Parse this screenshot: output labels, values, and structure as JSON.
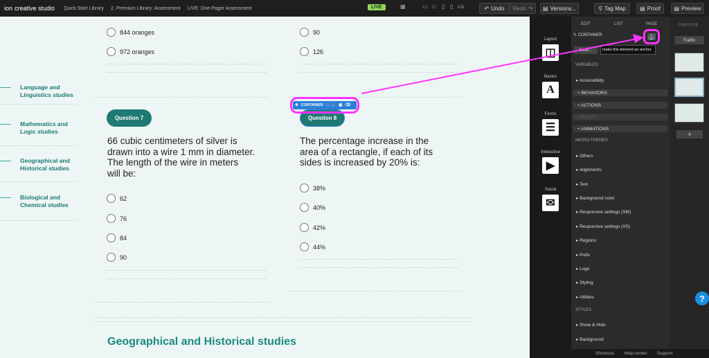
{
  "topbar": {
    "logo_ion": "ion",
    "logo_text": "creative studio",
    "breadcrumbs": [
      "Quick Start Library",
      "2. Premium Library: Assessment",
      "LIVE: One-Pager Assessment"
    ],
    "live_badge": "LIVE",
    "device_label": "LG",
    "undo": "Undo",
    "redo": "Redo",
    "versions": "Versions...",
    "tagmap": "Tag Map",
    "proof": "Proof",
    "preview": "Preview"
  },
  "sidebar_nav": [
    {
      "line1": "Language and",
      "line2": "Linguistics studies"
    },
    {
      "line1": "Mathematics and",
      "line2": "Logic studies"
    },
    {
      "line1": "Geographical and",
      "line2": "Historical studies"
    },
    {
      "line1": "Biological and",
      "line2": "Chemical studies"
    }
  ],
  "left_col": {
    "top_options": [
      "844 oranges",
      "972 oranges"
    ],
    "question_label": "Question 7",
    "question_text_lines": [
      "66 cubic centimeters of silver is",
      "drawn into a wire 1 mm in diameter.",
      "The length of the wire in meters",
      "will be:"
    ],
    "options": [
      "62",
      "76",
      "84",
      "90"
    ]
  },
  "right_col": {
    "top_options": [
      "90",
      "126"
    ],
    "question_label": "Question 8",
    "container_label": "CONTAINER",
    "question_text_lines": [
      "The percentage increase in the",
      "area of a rectangle, if each of its",
      "sides is increased by 20% is:"
    ],
    "options": [
      "38%",
      "40%",
      "42%",
      "44%"
    ]
  },
  "section_title": "Geographical and Historical studies",
  "tools": [
    "Layout",
    "Basics",
    "Forms",
    "Interactive",
    "Social"
  ],
  "panel": {
    "tabs": [
      "EDIT",
      "LIST",
      "PAGE"
    ],
    "container_title": "CONTAINER",
    "save_label": "Save...",
    "anchor_tooltip": "make this element an anchor",
    "variables_head": "VARIABLES",
    "accessibility": "Accessibility",
    "behaviors": "+ BEHAVIORS",
    "actions": "+ ACTIONS",
    "rules": "+ RULES",
    "animations": "+ ANIMATIONS",
    "micro_head": "MICRO-THEMES",
    "micro_items": [
      "Others",
      "Alignments",
      "Text",
      "Background color",
      "Responsive settings (SM)",
      "Responsive settings (XS)",
      "Regions",
      "Pods",
      "Logo",
      "Styling",
      "Utilities"
    ],
    "styles_head": "STYLES",
    "style_items": [
      "Show & Hide",
      "Background"
    ]
  },
  "right_panel": {
    "tab": "CREATIVE",
    "traffic": "Traffic",
    "add": "+"
  },
  "footer": {
    "shortcuts": "Shortcuts",
    "help": "Help center",
    "support": "Support"
  },
  "colors": {
    "accent": "#1f7a73",
    "highlight": "#ff33ff",
    "live": "#8fd45c",
    "help": "#1a8fe0"
  }
}
